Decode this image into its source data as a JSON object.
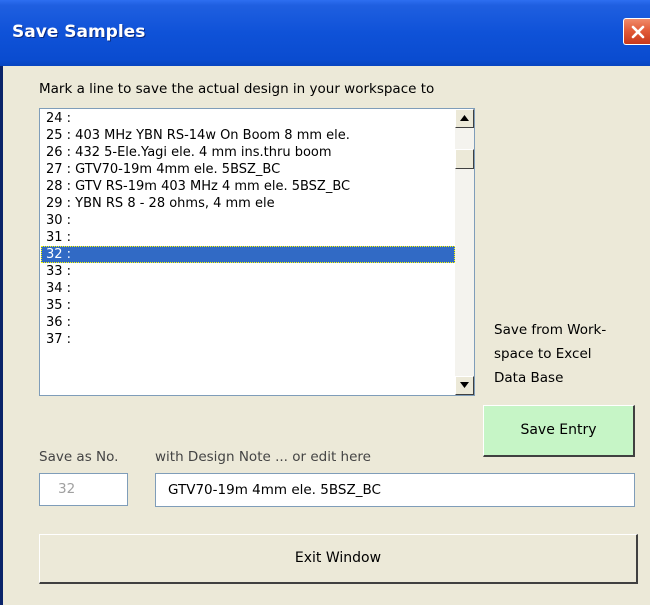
{
  "window": {
    "title": "Save Samples"
  },
  "instruction": "Mark a line to save the actual design in your workspace to",
  "list": {
    "items": [
      "24 :",
      "25 : 403 MHz YBN RS-14w On Boom 8 mm ele.",
      "26 : 432 5-Ele.Yagi  ele. 4 mm ins.thru boom",
      "27 : GTV70-19m  4mm ele. 5BSZ_BC",
      "28 : GTV RS-19m 403 MHz  4 mm ele. 5BSZ_BC",
      "29 : YBN RS 8 - 28 ohms, 4 mm ele",
      "30 :",
      "31 :",
      "32 :",
      "33 :",
      "34 :",
      "35 :",
      "36 :",
      "37 :"
    ],
    "selected_index": 8
  },
  "save_hint": {
    "line1": "Save from Work-",
    "line2": "space to Excel",
    "line3": "Data Base"
  },
  "save_entry_label": "Save Entry",
  "save_as_label": "Save as No.",
  "design_note_label": "with Design Note ... or edit here",
  "save_as_value": "32",
  "design_note_value": "GTV70-19m  4mm ele. 5BSZ_BC",
  "exit_label": "Exit Window",
  "colors": {
    "title_bar": "#0a4cd0",
    "selection": "#316ac5",
    "save_button": "#c6f5c6",
    "close_button": "#e25c3a",
    "dialog_face": "#ece9d8"
  }
}
